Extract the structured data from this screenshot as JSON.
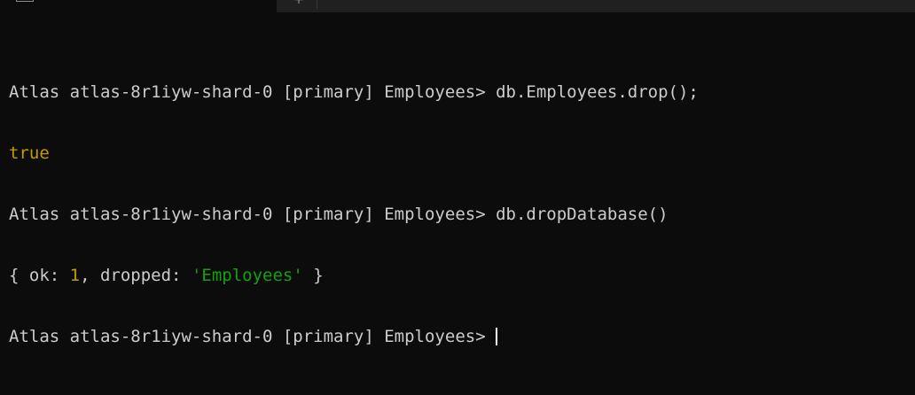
{
  "tabs": {
    "active_title": "",
    "new_tab_glyph": "+"
  },
  "terminal": {
    "prompt": "Atlas atlas-8r1iyw-shard-0 [primary] Employees> ",
    "lines": [
      {
        "type": "command",
        "command": "db.Employees.drop();"
      },
      {
        "type": "output",
        "text": "true"
      },
      {
        "type": "command",
        "command": "db.dropDatabase()"
      },
      {
        "type": "output_object",
        "open": "{ ok: ",
        "ok_value": "1",
        "mid": ", dropped: ",
        "dropped_value": "'Employees'",
        "close": " }"
      },
      {
        "type": "command",
        "command": ""
      }
    ]
  },
  "colors": {
    "background": "#0c0c0c",
    "foreground": "#cccccc",
    "number": "#c19c00",
    "string": "#13a10e",
    "boolean": "#c19c00"
  }
}
